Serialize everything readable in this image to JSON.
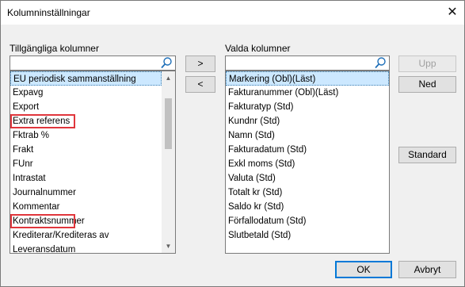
{
  "window": {
    "title": "Kolumninställningar"
  },
  "available": {
    "label": "Tillgängliga kolumner",
    "items": [
      {
        "label": "EU periodisk sammanställning",
        "selected": true
      },
      {
        "label": "Expavg"
      },
      {
        "label": "Export"
      },
      {
        "label": "Extra referens",
        "highlighted": true
      },
      {
        "label": "Fktrab %"
      },
      {
        "label": "Frakt"
      },
      {
        "label": "FUnr"
      },
      {
        "label": "Intrastat"
      },
      {
        "label": "Journalnummer"
      },
      {
        "label": "Kommentar"
      },
      {
        "label": "Kontraktsnummer",
        "highlighted": true
      },
      {
        "label": "Krediterar/Krediteras av"
      },
      {
        "label": "Leveransdatum"
      }
    ]
  },
  "selected_columns": {
    "label": "Valda kolumner",
    "items": [
      {
        "label": "Markering (Obl)(Läst)",
        "selected": true
      },
      {
        "label": "Fakturanummer (Obl)(Läst)"
      },
      {
        "label": "Fakturatyp (Std)"
      },
      {
        "label": "Kundnr (Std)"
      },
      {
        "label": "Namn (Std)"
      },
      {
        "label": "Fakturadatum (Std)"
      },
      {
        "label": "Exkl moms (Std)"
      },
      {
        "label": "Valuta (Std)"
      },
      {
        "label": "Totalt kr (Std)"
      },
      {
        "label": "Saldo kr (Std)"
      },
      {
        "label": "Förfallodatum (Std)"
      },
      {
        "label": "Slutbetald (Std)"
      }
    ]
  },
  "buttons": {
    "add": ">",
    "remove": "<",
    "up": "Upp",
    "down": "Ned",
    "standard": "Standard",
    "ok": "OK",
    "cancel": "Avbryt"
  },
  "icons": {
    "close": "close-icon",
    "search": "search-icon"
  },
  "colors": {
    "selection": "#cce8ff",
    "highlight_box": "#e0363c",
    "default_button_border": "#0078d7"
  }
}
